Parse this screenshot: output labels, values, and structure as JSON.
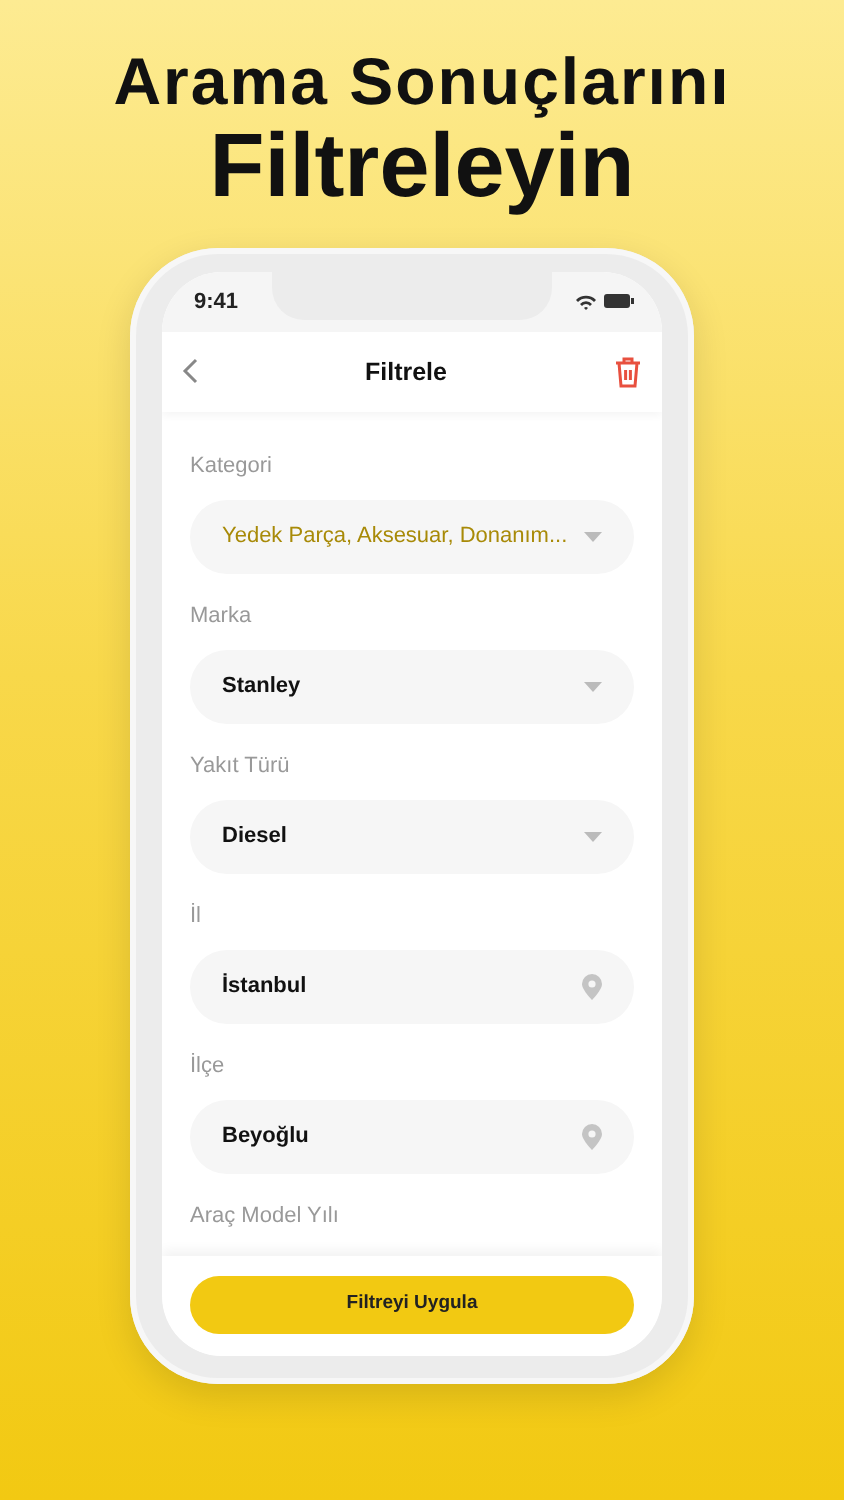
{
  "headline": [
    "Arama Sonuçlarını",
    "Filtreleyin"
  ],
  "status_bar": {
    "time": "9:41"
  },
  "nav": {
    "title": "Filtrele"
  },
  "filters": [
    {
      "label": "Kategori",
      "value": "Yedek Parça, Aksesuar, Donanım...",
      "kind": "dropdown",
      "highlighted": true
    },
    {
      "label": "Marka",
      "value": "Stanley",
      "kind": "dropdown",
      "highlighted": false
    },
    {
      "label": "Yakıt Türü",
      "value": "Diesel",
      "kind": "dropdown",
      "highlighted": false
    },
    {
      "label": "İl",
      "value": "İstanbul",
      "kind": "location",
      "highlighted": false
    },
    {
      "label": "İlçe",
      "value": "Beyoğlu",
      "kind": "location",
      "highlighted": false
    }
  ],
  "next_label": "Araç Model Yılı",
  "apply_button": "Filtreyi Uygula"
}
